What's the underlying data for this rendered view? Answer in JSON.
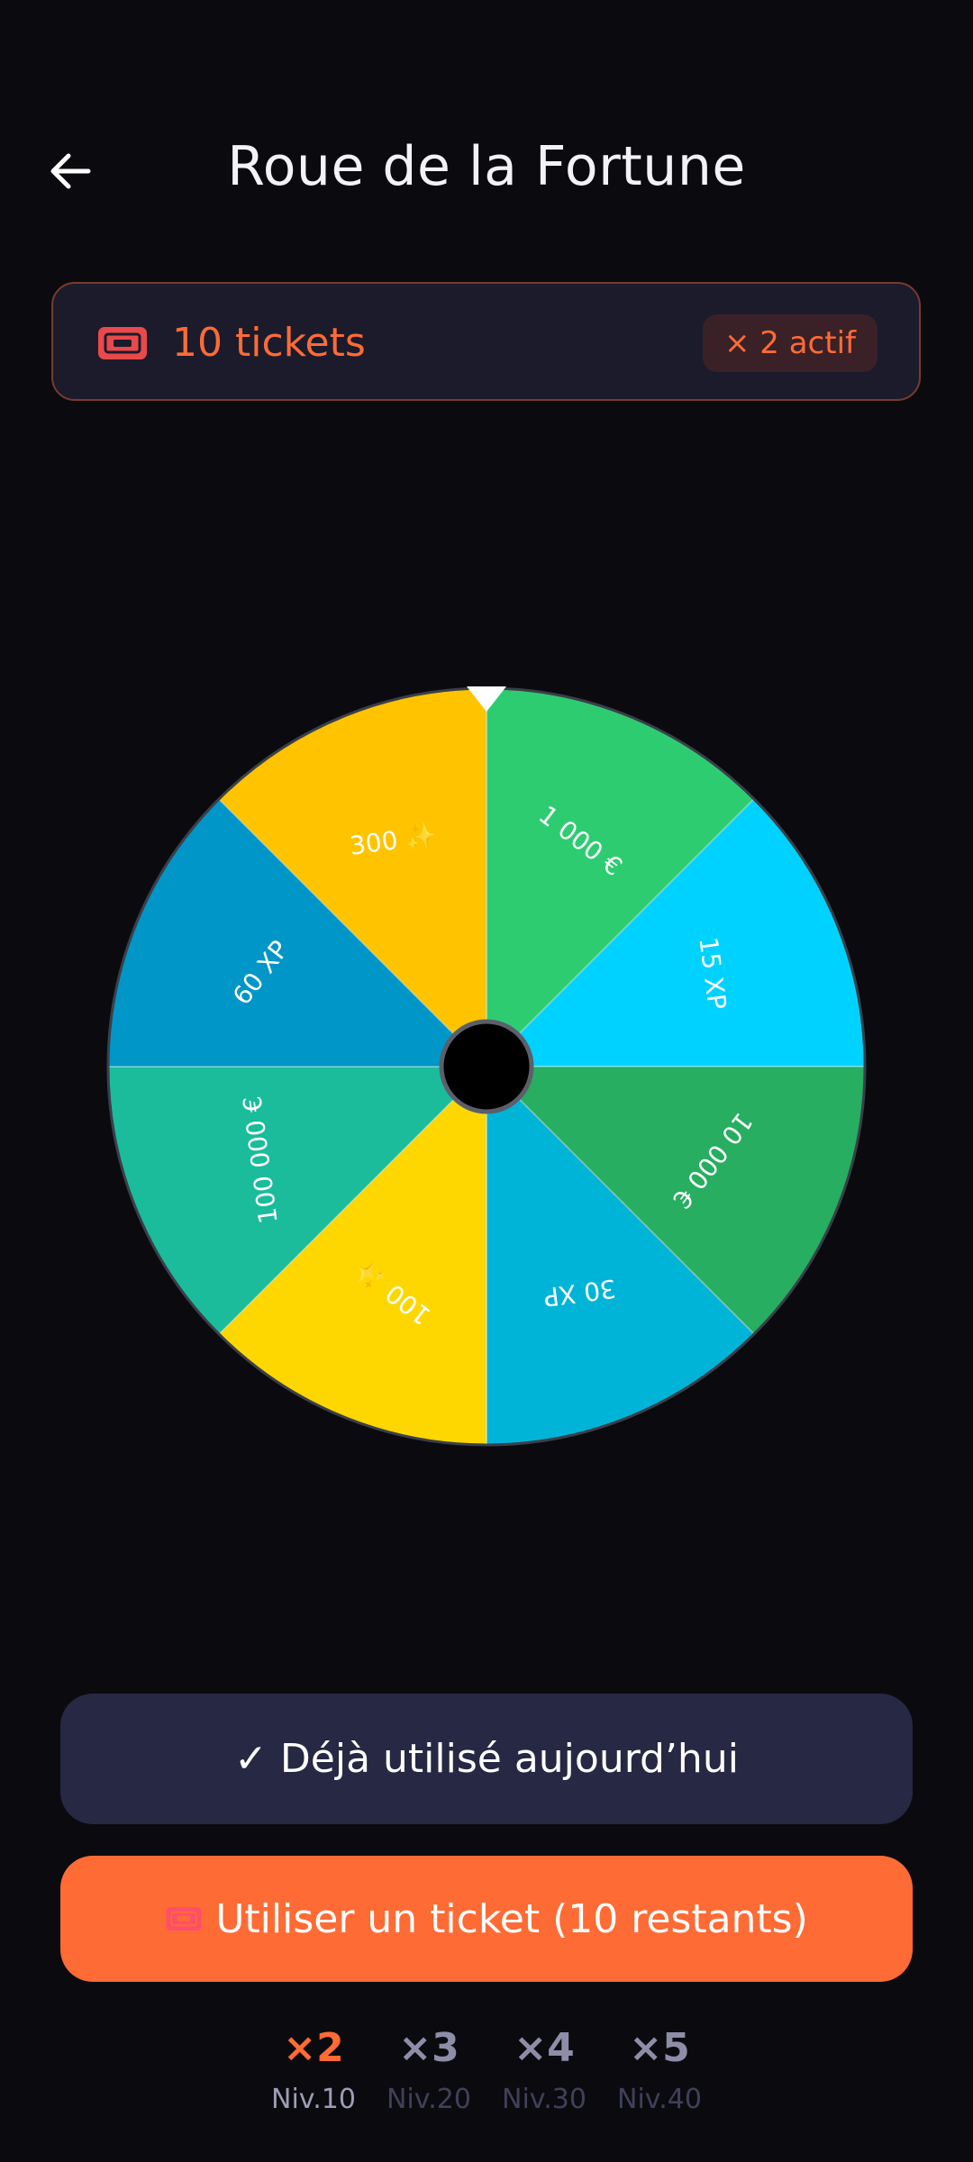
{
  "header": {
    "title": "Roue de la Fortune"
  },
  "tickets": {
    "count_label": "10 tickets",
    "multiplier_badge": "× 2 actif"
  },
  "wheel": {
    "segments": [
      {
        "label": "1 000 €",
        "color": "#2ecc71"
      },
      {
        "label": "15 XP",
        "color": "#00d2ff"
      },
      {
        "label": "10 000 €",
        "color": "#27ae60"
      },
      {
        "label": "30 XP",
        "color": "#00b4d8"
      },
      {
        "label": "100 ✨",
        "color": "#ffd700"
      },
      {
        "label": "100 000 €",
        "color": "#1abc9c"
      },
      {
        "label": "60 XP",
        "color": "#0096c7"
      },
      {
        "label": "300 ✨",
        "color": "#ffc300"
      }
    ]
  },
  "buttons": {
    "used_today": "✓ Déjà utilisé aujourd’hui",
    "use_ticket": "Utiliser un ticket (10 restants)"
  },
  "levels": [
    {
      "multiplier": "×2",
      "level": "Niv.10",
      "active": true
    },
    {
      "multiplier": "×3",
      "level": "Niv.20",
      "active": false
    },
    {
      "multiplier": "×4",
      "level": "Niv.30",
      "active": false
    },
    {
      "multiplier": "×5",
      "level": "Niv.40",
      "active": false
    }
  ],
  "colors": {
    "accent": "#ff6b35",
    "background": "#0b0b0f",
    "card": "#1b1b2c",
    "button_muted": "#272843"
  }
}
